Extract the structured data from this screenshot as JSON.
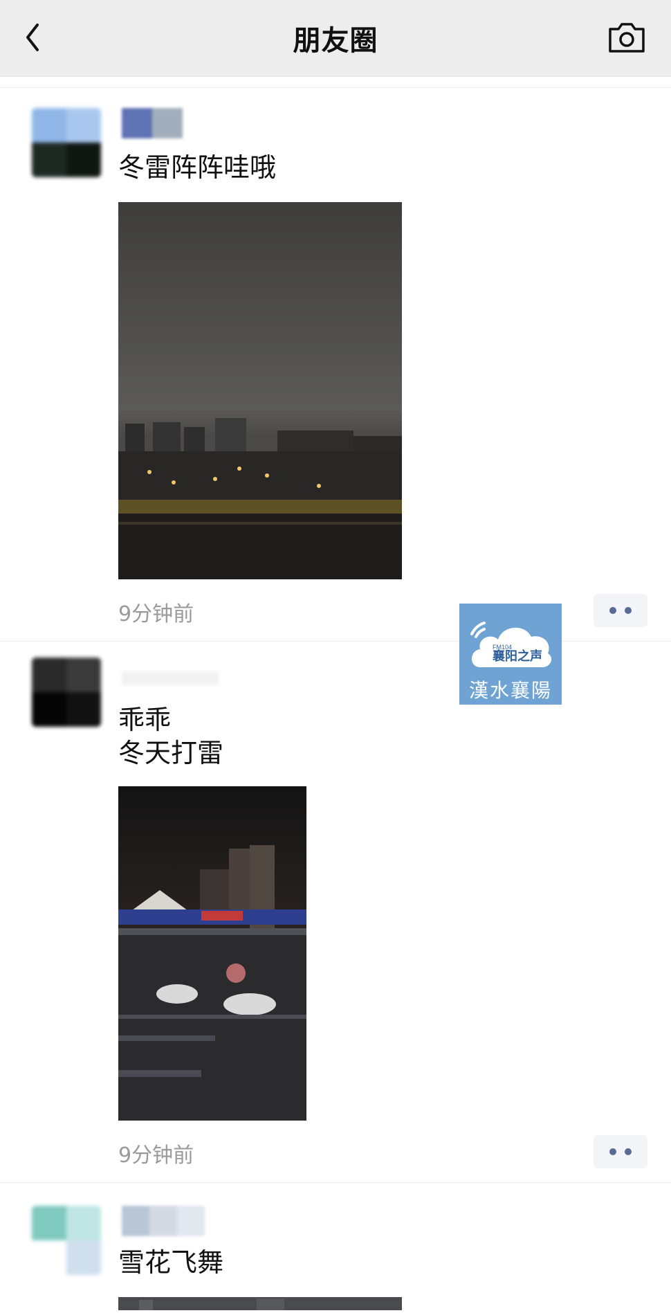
{
  "header": {
    "title": "朋友圈"
  },
  "posts": [
    {
      "text": "冬雷阵阵哇哦",
      "time": "9分钟前"
    },
    {
      "text": "乖乖\n冬天打雷",
      "time": "9分钟前"
    },
    {
      "text": "雪花飞舞"
    }
  ],
  "watermark": {
    "fm": "FM104",
    "station": "襄阳之声",
    "tagline": "漢水襄陽"
  },
  "colors": {
    "link": "#576b95",
    "header_bg": "#ededed",
    "timestamp": "#9a9a9a"
  }
}
